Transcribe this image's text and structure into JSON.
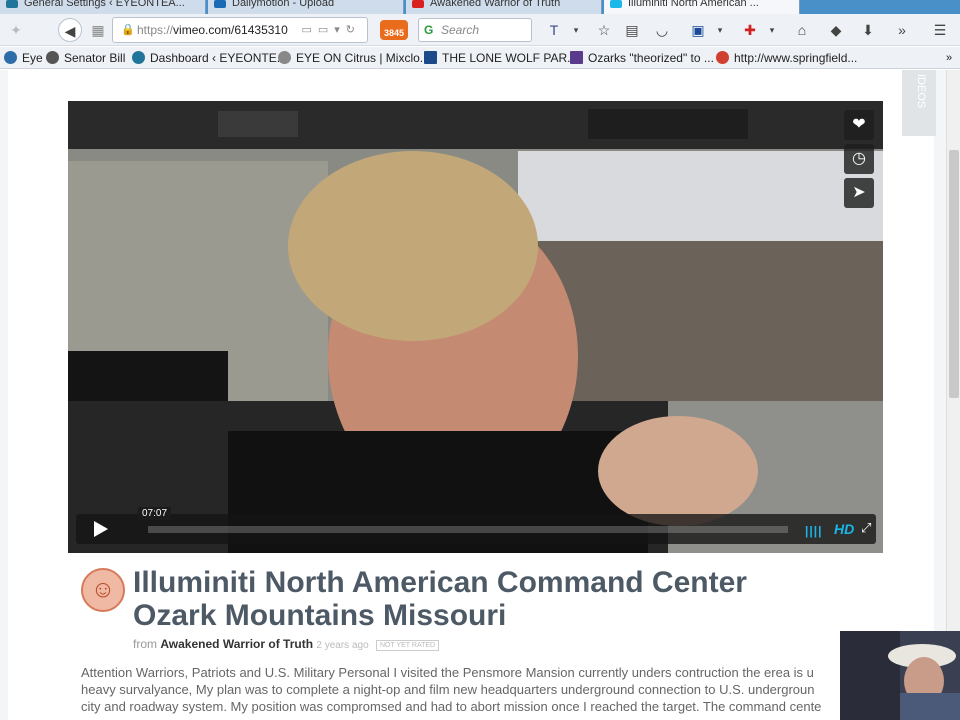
{
  "browser": {
    "tabs": [
      {
        "label": "General Settings ‹ EYEONTEA...",
        "icon": "wordpress-icon"
      },
      {
        "label": "Dailymotion - Upload",
        "icon": "dailymotion-icon"
      },
      {
        "label": "Awakened Warrior of Truth",
        "icon": "youtube-icon"
      },
      {
        "label": "Illuminiti North American ...",
        "icon": "vimeo-icon"
      }
    ],
    "url": {
      "protocol": "https://",
      "host": "vimeo.com/61435310"
    },
    "search_placeholder": "Search",
    "badge_count": "3845",
    "bookmarks": [
      {
        "label": "Eye",
        "color": "#2e6ea8"
      },
      {
        "label": "Senator Bill",
        "color": "#555555"
      },
      {
        "label": "Dashboard ‹ EYEONTE...",
        "color": "#21759b"
      },
      {
        "label": "EYE ON Citrus | Mixclo...",
        "color": "#888888"
      },
      {
        "label": "THE LONE WOLF PAR...",
        "color": "#1a4a8a"
      },
      {
        "label": "Ozarks \"theorized\" to ...",
        "color": "#5a3a8a"
      },
      {
        "label": "http://www.springfield...",
        "color": "#d04030"
      }
    ]
  },
  "sidebar_tab_label": "IDEOS",
  "video": {
    "timestamp": "07:07",
    "quality_label": "HD",
    "progress_fraction": 0.0,
    "actions": [
      "heart-icon",
      "clock-icon",
      "send-icon"
    ]
  },
  "clip": {
    "title_line1": "Illuminiti North American Command Center",
    "title_line2": "Ozark Mountains Missouri",
    "from_label": "from",
    "author": "Awakened Warrior of Truth",
    "posted": "2 years ago",
    "rating": "NOT YET RATED",
    "description": [
      "Attention Warriors, Patriots and U.S. Military Personal I visited the Pensmore Mansion currently unders contruction the erea is u",
      "heavy survalyance, My plan was to complete a night-op and film new headquarters underground connection to U.S. undergroun",
      "city and roadway system. My position was compromsed and had to abort mission once I reached the target. The command cente"
    ]
  },
  "colors": {
    "accent": "#1ab7ea",
    "title": "#4d5a66"
  }
}
